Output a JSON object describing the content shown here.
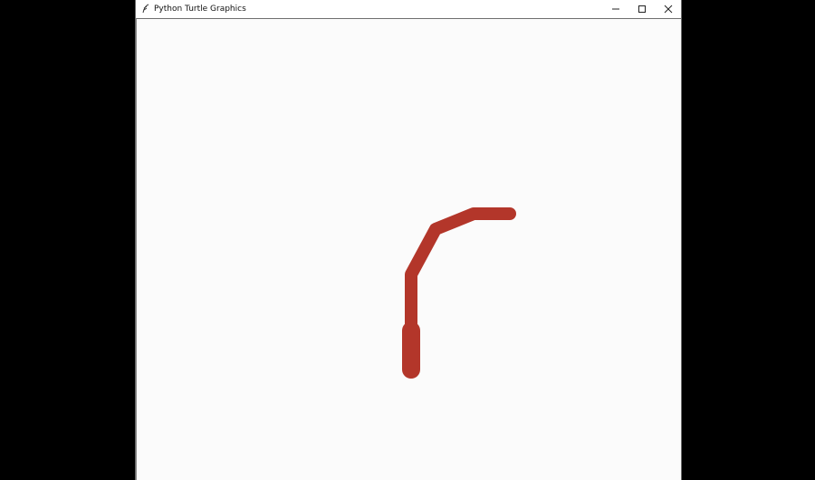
{
  "window": {
    "title": "Python Turtle Graphics",
    "app_icon": "feather-icon",
    "controls": {
      "minimize_icon": "minimize-icon",
      "maximize_icon": "maximize-icon",
      "close_icon": "close-icon"
    }
  },
  "canvas": {
    "background": "#fbfbfb",
    "pen_color": "#b3362a"
  }
}
